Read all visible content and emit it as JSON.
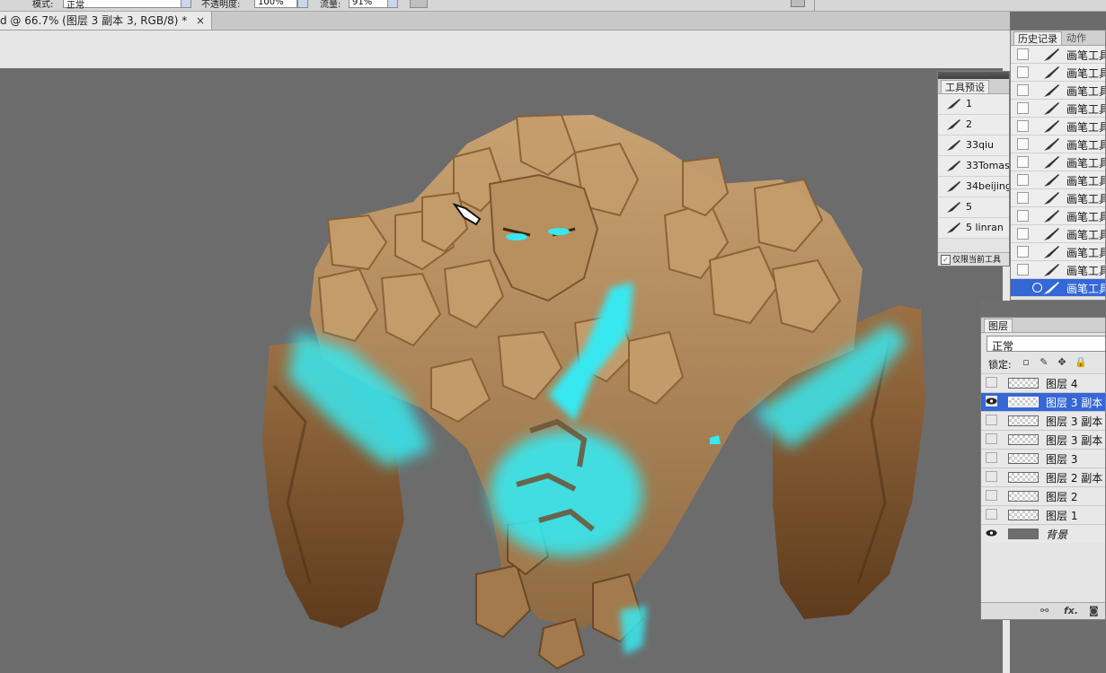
{
  "options_bar": {
    "mode_label": "模式:",
    "mode_value": "正常",
    "opacity_label": "不透明度:",
    "opacity_value": "100%",
    "flow_label": "流量:",
    "flow_value": "91%"
  },
  "document": {
    "tab_title": "d @ 66.7% (图层 3 副本 3, RGB/8) *",
    "close_glyph": "×"
  },
  "history_panel": {
    "tabs": [
      "历史记录",
      "动作"
    ],
    "items": [
      "画笔工具",
      "画笔工具",
      "画笔工具",
      "画笔工具",
      "画笔工具",
      "画笔工具",
      "画笔工具",
      "画笔工具",
      "画笔工具",
      "画笔工具",
      "画笔工具",
      "画笔工具",
      "画笔工具",
      "画笔工具"
    ],
    "selected_index": 13
  },
  "presets_panel": {
    "tab": "工具预设",
    "items": [
      "1",
      "2",
      "33qiu",
      "33Tomas",
      "34beijing",
      "5",
      "5 linran"
    ],
    "footer_label": "仅限当前工具"
  },
  "layers_panel": {
    "tab": "图层",
    "blend_mode": "正常",
    "lock_label": "锁定:",
    "layers": [
      {
        "name": "图层 4",
        "visible": false,
        "selected": false
      },
      {
        "name": "图层 3 副本",
        "visible": true,
        "selected": true
      },
      {
        "name": "图层 3 副本",
        "visible": false,
        "selected": false
      },
      {
        "name": "图层 3 副本",
        "visible": false,
        "selected": false
      },
      {
        "name": "图层 3",
        "visible": false,
        "selected": false
      },
      {
        "name": "图层 2 副本",
        "visible": false,
        "selected": false
      },
      {
        "name": "图层 2",
        "visible": false,
        "selected": false
      },
      {
        "name": "图层 1",
        "visible": false,
        "selected": false
      },
      {
        "name": "背景",
        "visible": true,
        "selected": false
      }
    ],
    "footer_fx": "fx."
  },
  "colors": {
    "selection_blue": "#3567d6",
    "glow_cyan": "#38e8f0",
    "rock_tan": "#b99265",
    "canvas_gray": "#6c6c6c"
  }
}
